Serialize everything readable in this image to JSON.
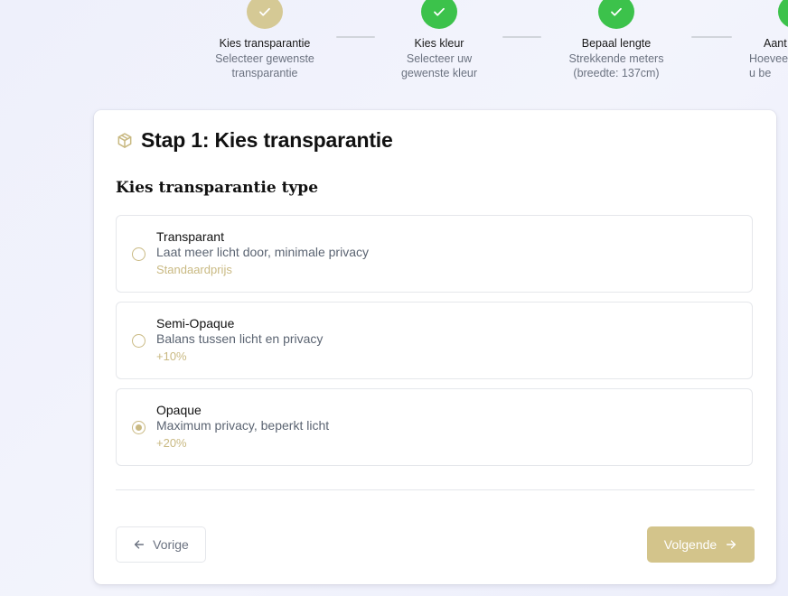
{
  "colors": {
    "accent_gold": "#c9b982",
    "step_done_green": "#3cc24b",
    "step_current_gold": "#d5c995",
    "button_primary": "#d3c48b"
  },
  "stepper": {
    "steps": [
      {
        "title": "Kies transparantie",
        "desc": "Selecteer gewenste transparantie",
        "state": "current",
        "icon": "check-icon"
      },
      {
        "title": "Kies kleur",
        "desc": "Selecteer uw gewenste kleur",
        "state": "done",
        "icon": "check-icon"
      },
      {
        "title": "Bepaal lengte",
        "desc": "Strekkende meters (breedte: 137cm)",
        "state": "done",
        "icon": "check-icon"
      },
      {
        "title": "Aant",
        "desc": "Hoevee u be",
        "state": "done",
        "icon": "check-icon"
      }
    ]
  },
  "card": {
    "icon": "package-icon",
    "title": "Stap 1: Kies transparantie",
    "section_title": "Kies transparantie type",
    "options": [
      {
        "name": "Transparant",
        "desc": "Laat meer licht door, minimale privacy",
        "price": "Standaardprijs",
        "selected": false
      },
      {
        "name": "Semi-Opaque",
        "desc": "Balans tussen licht en privacy",
        "price": "+10%",
        "selected": false
      },
      {
        "name": "Opaque",
        "desc": "Maximum privacy, beperkt licht",
        "price": "+20%",
        "selected": true
      }
    ]
  },
  "nav": {
    "prev_label": "Vorige",
    "prev_icon": "arrow-left-icon",
    "next_label": "Volgende",
    "next_icon": "arrow-right-icon"
  }
}
